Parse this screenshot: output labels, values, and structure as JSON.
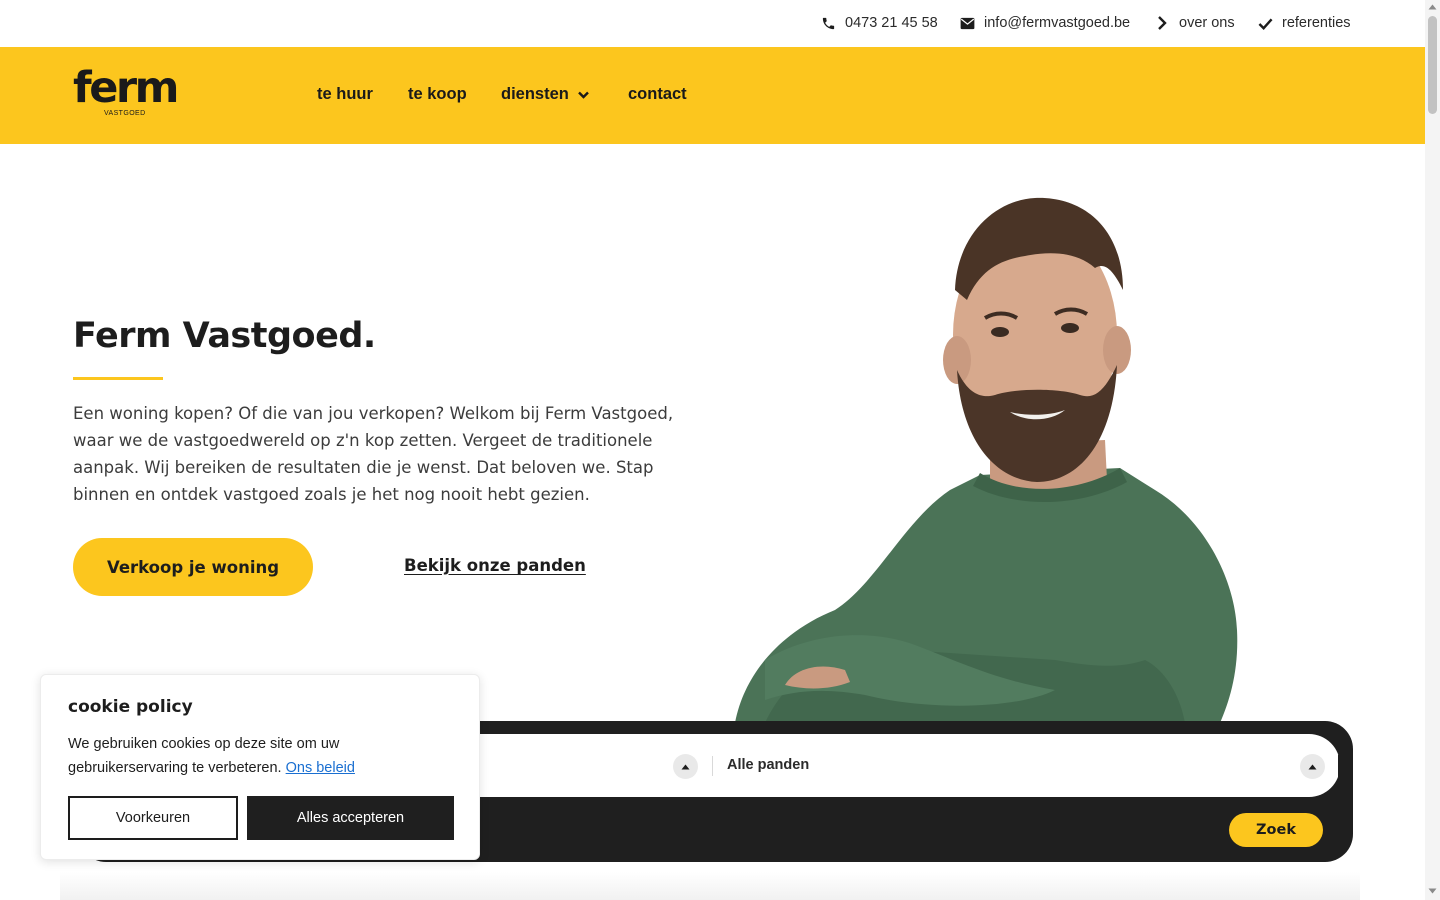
{
  "topbar": {
    "phone": "0473 21 45 58",
    "email": "info@fermvastgoed.be",
    "about": "over ons",
    "references": "referenties",
    "icons": [
      "phone-icon",
      "mail-icon",
      "chevron-right-icon",
      "check-icon"
    ]
  },
  "header": {
    "logo_word": "ferm",
    "logo_sub": "VASTGOED",
    "nav": {
      "rent": "te huur",
      "sale": "te koop",
      "services": "diensten",
      "contact": "contact"
    }
  },
  "hero": {
    "title": "Ferm Vastgoed.",
    "text": "Een woning kopen? Of die van jou verkopen? Welkom bij Ferm Vastgoed, waar we de vastgoedwereld op z'n kop zetten. Vergeet de traditionele aanpak. Wij bereiken de resultaten die je wenst. Dat beloven we. Stap binnen en ontdek vastgoed zoals je het nog nooit hebt gezien.",
    "primary_button": "Verkoop je woning",
    "secondary_link": "Bekijk onze panden"
  },
  "search": {
    "type_value": "Alle panden",
    "submit": "Zoek"
  },
  "cookie": {
    "title": "cookie policy",
    "text": "We gebruiken cookies op deze site om uw gebruikerservaring te verbeteren.",
    "policy_link": "Ons beleid",
    "preferences": "Voorkeuren",
    "accept_all": "Alles accepteren"
  },
  "colors": {
    "brand_yellow": "#fcc61e",
    "dark": "#1f1f1f",
    "link_blue": "#1a6fd1"
  }
}
